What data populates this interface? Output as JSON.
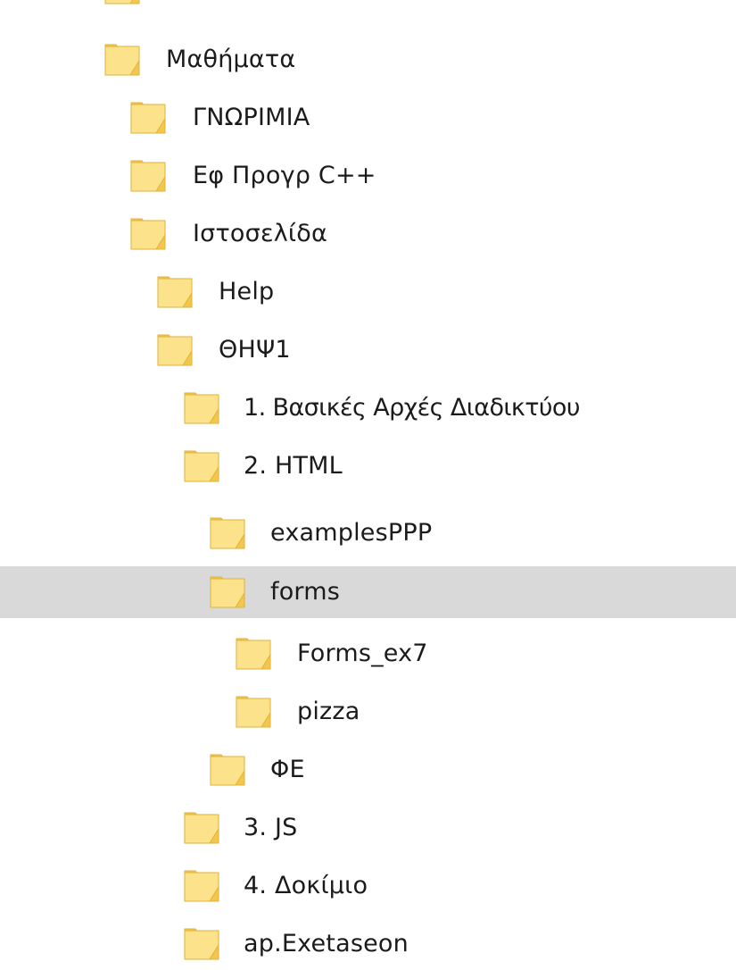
{
  "explorer": {
    "folder_icon": "folder-icon",
    "colors": {
      "folder_face": "#FCE28A",
      "folder_tab": "#F3C64C",
      "folder_edge": "#E0B23A",
      "selection": "#D9D9D9",
      "text": "#1B1B1B"
    },
    "tree": [
      {
        "label": "",
        "level": 0,
        "selected": false
      },
      {
        "label": "Μαθήματα",
        "level": 0,
        "selected": false
      },
      {
        "label": "ΓΝΩΡΙΜΙΑ",
        "level": 1,
        "selected": false
      },
      {
        "label": "Εφ Προγρ C++",
        "level": 1,
        "selected": false
      },
      {
        "label": "Ιστοσελίδα",
        "level": 1,
        "selected": false
      },
      {
        "label": "Help",
        "level": 2,
        "selected": false
      },
      {
        "label": "ΘΗΨ1",
        "level": 2,
        "selected": false
      },
      {
        "label": "1. Βασικές Αρχές Διαδικτύου",
        "level": 3,
        "selected": false
      },
      {
        "label": "2. HTML",
        "level": 3,
        "selected": false
      },
      {
        "label": "examplesPPP",
        "level": 4,
        "selected": false
      },
      {
        "label": "forms",
        "level": 4,
        "selected": true
      },
      {
        "label": "Forms_ex7",
        "level": 5,
        "selected": false
      },
      {
        "label": "pizza",
        "level": 5,
        "selected": false
      },
      {
        "label": "ΦΕ",
        "level": 4,
        "selected": false
      },
      {
        "label": "3. JS",
        "level": 3,
        "selected": false
      },
      {
        "label": "4. Δοκίμιο",
        "level": 3,
        "selected": false
      },
      {
        "label": "ap.Exetaseon",
        "level": 3,
        "selected": false
      }
    ]
  }
}
